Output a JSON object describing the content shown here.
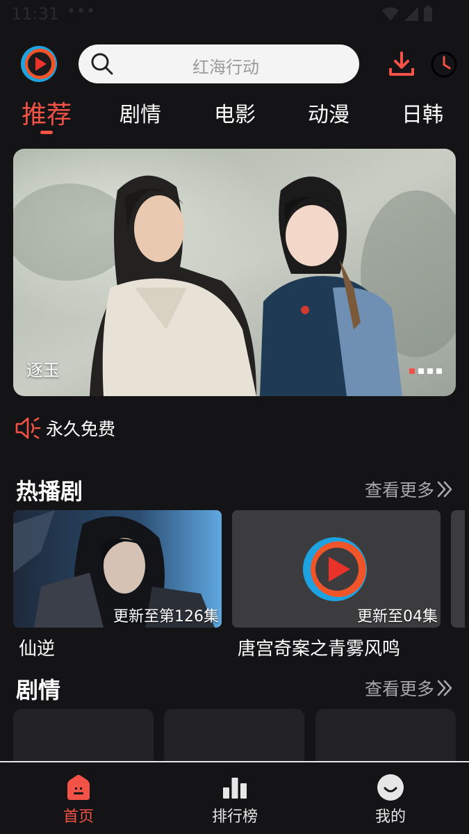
{
  "status_bar": {
    "time": "11:31",
    "notification_dots": "•••"
  },
  "search": {
    "placeholder": "红海行动"
  },
  "tabs": [
    {
      "label": "推荐",
      "active": true
    },
    {
      "label": "剧情",
      "active": false
    },
    {
      "label": "电影",
      "active": false
    },
    {
      "label": "动漫",
      "active": false
    },
    {
      "label": "日韩",
      "active": false
    }
  ],
  "banner": {
    "title": "逐玉",
    "slide_count": 4,
    "active_slide": 1
  },
  "notice": {
    "text": "永久免费",
    "icon": "speaker-icon"
  },
  "hot_section": {
    "title": "热播剧",
    "more_label": "查看更多",
    "items": [
      {
        "title": "仙逆",
        "badge": "更新至第126集"
      },
      {
        "title": "唐宫奇案之青雾风鸣",
        "badge": "更新至04集"
      }
    ]
  },
  "drama_section": {
    "title": "剧情",
    "more_label": "查看更多"
  },
  "bottom_nav": [
    {
      "label": "首页",
      "icon": "home-icon",
      "active": true
    },
    {
      "label": "排行榜",
      "icon": "chart-icon",
      "active": false
    },
    {
      "label": "我的",
      "icon": "profile-icon",
      "active": false
    }
  ],
  "colors": {
    "accent": "#f25346",
    "background": "#141416",
    "logo_blue": "#1fa3e0",
    "logo_orange": "#f0552a"
  }
}
